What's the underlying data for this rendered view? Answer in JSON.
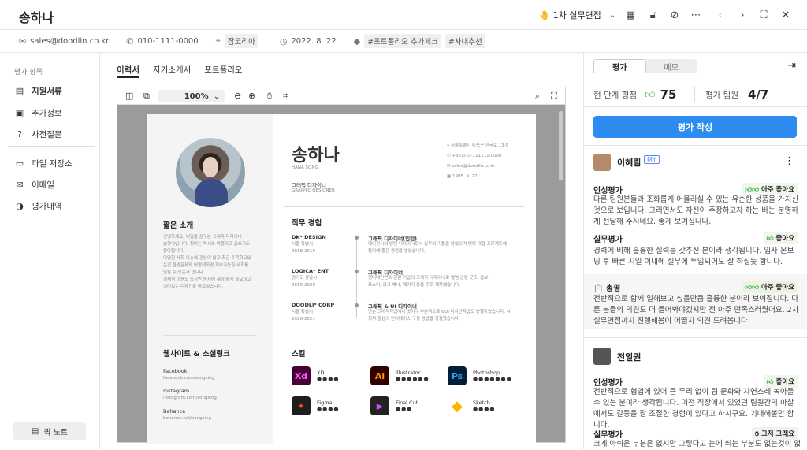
{
  "header": {
    "name": "송하나",
    "stage": "1차 실무면접",
    "stage_icon": "🤚"
  },
  "info": {
    "email": "sales@doodlin.co.kr",
    "phone": "010-1111-0000",
    "source": "잡코리아",
    "date": "2022. 8. 22",
    "tags": [
      "#포트폴리오 추가체크",
      "#사내추천"
    ]
  },
  "sidebar": {
    "title": "평가 항목",
    "items": [
      "지원서류",
      "추가정보",
      "사전질문",
      "파일 저장소",
      "이메일",
      "평가내역"
    ],
    "quick_note": "퀵 노트"
  },
  "tabs": [
    "이력서",
    "자기소개서",
    "포트폴리오"
  ],
  "viewer": {
    "zoom": "100%"
  },
  "resume": {
    "name": "송하나",
    "name_en": "HANA SONG",
    "role": "그래픽 디자이너",
    "role_en": "GRAPHIC DESIGNER",
    "contact": [
      "서울특별시 마포구 한국로 13-5",
      "+82)010-111111-0000",
      "sales@doodlin.co.kr",
      "1995. 9. 27"
    ],
    "intro_title": "짧은 소개",
    "intro": [
      "안녕하세요, 내일을 꿈꾸는 그래픽 디자이너",
      "송하나입니다. 취미는 독서와 여행이고 글쓰기도",
      "좋아합니다.",
      "다양한 사회 이슈에 관심이 많고 최근 주목하고있",
      "는건 환경문제와 어떻게하면 지속가능한 사회를",
      "만들 수 있는가 입니다.",
      "경제적 이윤도 중지만 동시에 세상에 꼭 필요하고",
      "의미있는 디자인을 하고싶습니다."
    ],
    "web_title": "웹사이트 & 소셜링크",
    "links": [
      {
        "name": "Facebook",
        "url": "facebook.com/songsing"
      },
      {
        "name": "Instagram",
        "url": "instagram.com/songsing"
      },
      {
        "name": "Behance",
        "url": "behance.net/songsing"
      }
    ],
    "exp_title": "직무 경험",
    "experience": [
      {
        "company": "DK* DESIGN",
        "loc": "서울 특별시",
        "period": "2018-2019",
        "role": "그래픽 디자이너(인턴)",
        "desc": [
          "에이전시의 인턴 디자이너로서 실무의 기틀을 닦았으며 몇몇 대형 프로젝트에",
          "참여해 좋은 경험을 쌓았습니다."
        ]
      },
      {
        "company": "LOGICA* ENT",
        "loc": "경기도 성남시",
        "period": "2019-2020",
        "role": "그래픽 디자이너",
        "desc": [
          "엔터테인먼트 관련 기업의 그래픽 디자이너로 앨범 관련 굿즈, 홍보",
          "포스터, 광고 배너, 패키지 등을 주로 제작했습니다."
        ]
      },
      {
        "company": "DOODLI* CORP",
        "loc": "서울 특별시",
        "period": "2020-2021",
        "role": "그래픽 & UI 디자이너",
        "desc": [
          "단순 그래픽작업에서 벗어나 부분적으로 GUI 디자인작업도 병행하였습니다. 사",
          "회적 중심의 인터페이스 구성 방법을 경험했습니다."
        ]
      }
    ],
    "skills_title": "스킬",
    "skills": [
      {
        "name": "XD",
        "abbr": "Xd",
        "color": "#470137",
        "level": 4
      },
      {
        "name": "Illustrator",
        "abbr": "Ai",
        "color": "#330000",
        "level": 6
      },
      {
        "name": "Photoshop",
        "abbr": "Ps",
        "color": "#001E36",
        "level": 7
      },
      {
        "name": "Figma",
        "abbr": "✦",
        "color": "#1e1e1e",
        "level": 4
      },
      {
        "name": "Final Cut",
        "abbr": "▶",
        "color": "#222222",
        "level": 3
      },
      {
        "name": "Sketch",
        "abbr": "◆",
        "color": "#fdb300",
        "level": 4
      }
    ]
  },
  "panel": {
    "tabs": [
      "평가",
      "메모"
    ],
    "stage_score_label": "현 단계 평점",
    "stage_score": "75",
    "team_label": "평가 팀원",
    "team_value": "4/7",
    "write_button": "평가 작성",
    "reviews": [
      {
        "name": "이혜림",
        "my": "MY",
        "sections": [
          {
            "title": "인성평가",
            "badge": "아주 좋아요",
            "text": "다른 팀원분들과 조화롭게 어울리실 수 있는 유순한 성품을 가지신 것으로 보입니다. 그러면서도 자신이 주장하고자 하는 바는 분명하게 전달해 주시네요. 좋게 보여집니다."
          },
          {
            "title": "실무평가",
            "badge": "좋아요",
            "text": "경력에 비해 훌륭한 실력을 갖추신 분이라 생각됩니다. 입사 온보딩 후 빠른 시일 이내에 실무에 투입되어도 잘 하실듯 합니다."
          },
          {
            "title": "📋 총평",
            "badge": "아주 좋아요",
            "text": "전반적으로 함께 일해보고 싶을만큼 훌륭한 분이라 보여집니다. 다른 분들의 의견도 더 들어봐야겠지만 전 아주 만족스러웠어요. 2차 실무면접까지 진행해봄이 어떨지 의견 드려봅니다!"
          }
        ]
      },
      {
        "name": "전일권",
        "sections": [
          {
            "title": "인성평가",
            "badge": "좋아요",
            "text": "전반적으로 협업에 있어 큰 무리 없이 팀 문화와 자연스레 녹아들 수 있는 분이라 생각됩니다. 이전 직장에서 있었던 팀원간의 마찰에서도 갈등을 잘 조절한 경험이 있다고 하시구요. 기대해볼만 합니다."
          },
          {
            "title": "실무평가",
            "badge": "그저 그래요",
            "text": "크게 아쉬운 부분은 없지만 그렇다고 눈에 띄는 부분도 없는것이 없습"
          }
        ]
      }
    ]
  }
}
